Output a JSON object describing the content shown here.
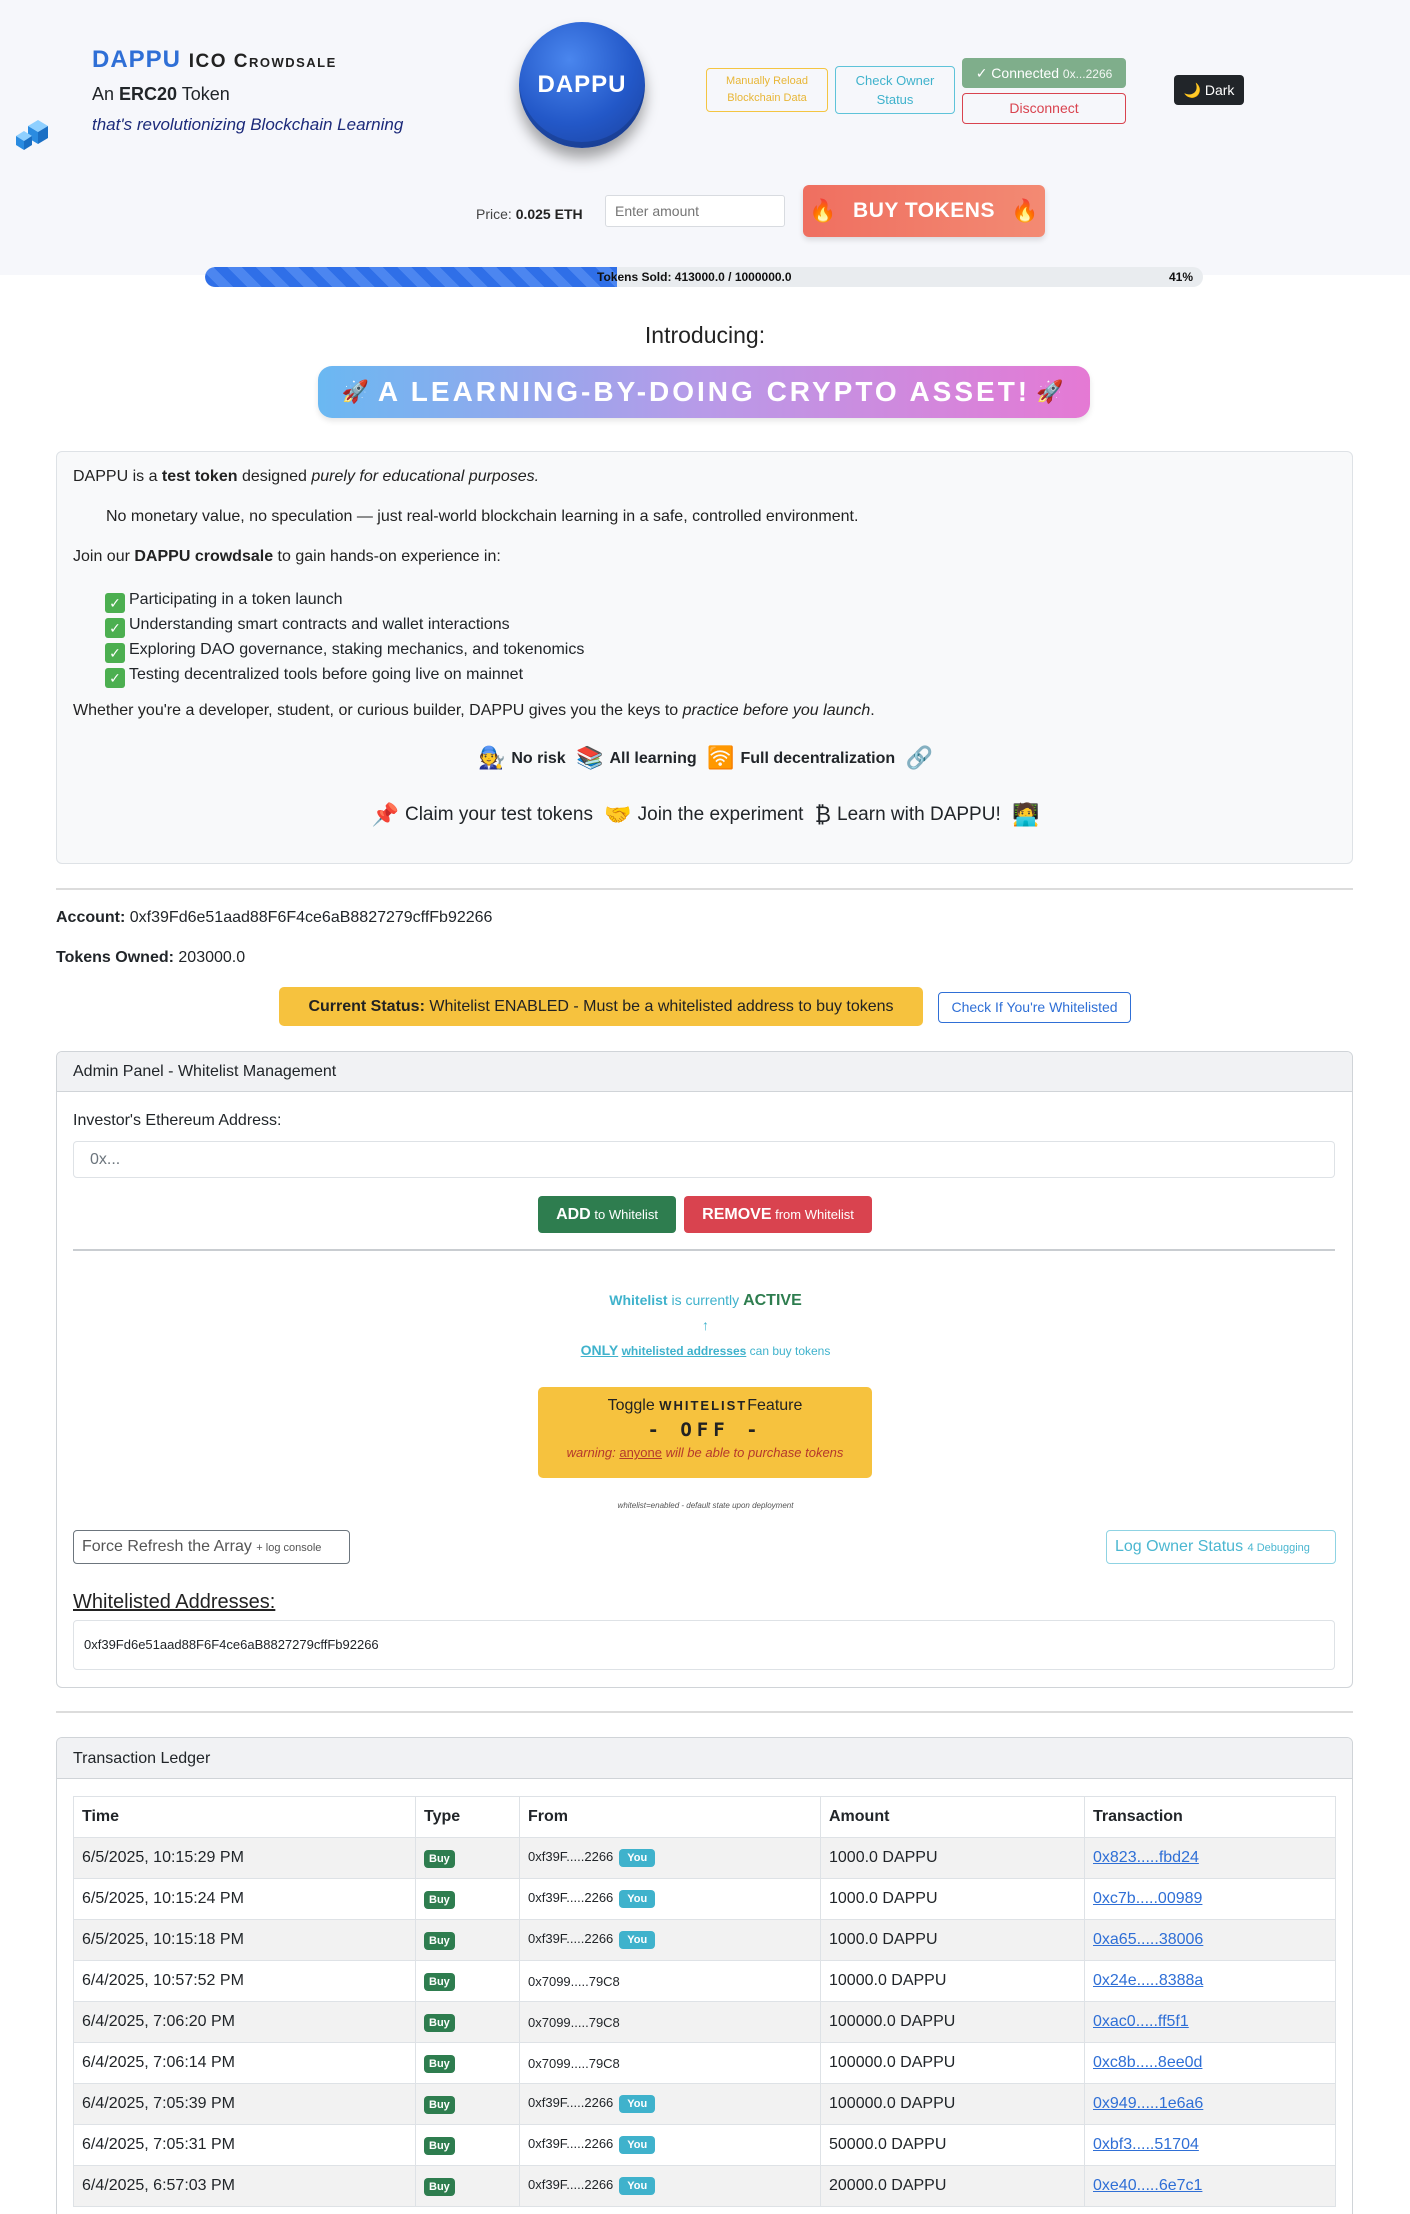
{
  "header": {
    "brand_name": "DAPPU",
    "brand_suffix": "ICO Crowdsale",
    "subtitle_pre": "An",
    "subtitle_bold": "ERC20",
    "subtitle_post": "Token",
    "tagline": "that's revolutionizing Blockchain Learning",
    "coin_label": "DAPPU",
    "reload_label": "Manually Reload Blockchain Data",
    "owner_status_label": "Check Owner Status",
    "connected_label": "✓ Connected",
    "connected_addr": "0x...2266",
    "disconnect_label": "Disconnect",
    "dark_label": "🌙 Dark",
    "icons": {
      "logo": "blue-cube-icon",
      "dark_mode": "moon-icon"
    }
  },
  "purchase": {
    "price_label": "Price:",
    "price_value": "0.025 ETH",
    "amount_placeholder": "Enter amount",
    "buy_label": "BUY TOKENS",
    "buy_icon": "🔥"
  },
  "progress": {
    "text": "Tokens Sold: 413000.0 / 1000000.0",
    "percent_label": "41%",
    "percent": 41.3,
    "color": "#2f6fe8"
  },
  "intro": {
    "heading": "Introducing:",
    "banner": "A LEARNING-BY-DOING CRYPTO ASSET!",
    "banner_icon": "🚀",
    "p1_pre": "DAPPU is a",
    "p1_bold": "test token",
    "p1_mid": "designed",
    "p1_italic": "purely for educational purposes.",
    "p2": "No monetary value, no speculation — just real-world blockchain learning in a safe, controlled environment.",
    "p3_pre": "Join our",
    "p3_bold": "DAPPU crowdsale",
    "p3_post": "to gain hands-on experience in:",
    "items": [
      "Participating in a token launch",
      "Understanding smart contracts and wallet interactions",
      "Exploring DAO governance, staking mechanics, and tokenomics",
      "Testing decentralized tools before going live on mainnet"
    ],
    "p4_pre": "Whether you're a developer, student, or curious builder, DAPPU gives you the keys to",
    "p4_italic": "practice before you launch",
    "p4_post": ".",
    "features": [
      "No risk",
      "All learning",
      "Full decentralization"
    ],
    "feature_icons": [
      "🧑‍🔧",
      "📚",
      "🛜",
      "🔗"
    ],
    "claims": [
      "Claim your test tokens",
      "Join the experiment",
      "Learn with DAPPU!"
    ],
    "claim_icons": [
      "📌",
      "🤝",
      "₿",
      "🧑‍💻"
    ]
  },
  "account": {
    "account_label": "Account:",
    "account_value": "0xf39Fd6e51aad88F6F4ce6aB8827279cffFb92266",
    "tokens_label": "Tokens Owned:",
    "tokens_value": "203000.0",
    "status_label": "Current Status:",
    "status_value": "Whitelist ENABLED - Must be a whitelisted address to buy tokens",
    "check_wl_label": "Check If You're Whitelisted"
  },
  "admin": {
    "title": "Admin Panel - Whitelist Management",
    "address_label": "Investor's Ethereum Address:",
    "address_placeholder": "0x...",
    "add_bold": "ADD",
    "add_rest": "to Whitelist",
    "remove_bold": "REMOVE",
    "remove_rest": "from Whitelist",
    "active_pre": "Whitelist",
    "active_mid": "is currently",
    "active_state": "ACTIVE",
    "arrow": "↑",
    "only_word": "ONLY",
    "only_link": "whitelisted addresses",
    "only_post": "can buy tokens",
    "toggle_pre": "Toggle",
    "toggle_word": "WHITELIST",
    "toggle_post": "Feature",
    "toggle_state": "- OFF -",
    "warning_pre": "warning:",
    "warning_u": "anyone",
    "warning_post": "will be able to purchase tokens",
    "default_note": "whitelist=enabled - default state upon deployment",
    "force_label": "Force Refresh the Array",
    "force_small": "+ log console",
    "log_label": "Log Owner Status",
    "log_small": "4 Debugging",
    "wl_heading": "Whitelisted Addresses:",
    "wl_addresses": [
      "0xf39Fd6e51aad88F6F4ce6aB8827279cffFb92266"
    ]
  },
  "ledger": {
    "title": "Transaction Ledger",
    "columns": [
      "Time",
      "Type",
      "From",
      "Amount",
      "Transaction"
    ],
    "you_label": "You",
    "rows": [
      {
        "time": "6/5/2025, 10:15:29 PM",
        "type": "Buy",
        "from": "0xf39F.....2266",
        "you": true,
        "amount": "1000.0 DAPPU",
        "tx": "0x823.....fbd24"
      },
      {
        "time": "6/5/2025, 10:15:24 PM",
        "type": "Buy",
        "from": "0xf39F.....2266",
        "you": true,
        "amount": "1000.0 DAPPU",
        "tx": "0xc7b.....00989"
      },
      {
        "time": "6/5/2025, 10:15:18 PM",
        "type": "Buy",
        "from": "0xf39F.....2266",
        "you": true,
        "amount": "1000.0 DAPPU",
        "tx": "0xa65.....38006"
      },
      {
        "time": "6/4/2025, 10:57:52 PM",
        "type": "Buy",
        "from": "0x7099.....79C8",
        "you": false,
        "amount": "10000.0 DAPPU",
        "tx": "0x24e.....8388a"
      },
      {
        "time": "6/4/2025, 7:06:20 PM",
        "type": "Buy",
        "from": "0x7099.....79C8",
        "you": false,
        "amount": "100000.0 DAPPU",
        "tx": "0xac0.....ff5f1"
      },
      {
        "time": "6/4/2025, 7:06:14 PM",
        "type": "Buy",
        "from": "0x7099.....79C8",
        "you": false,
        "amount": "100000.0 DAPPU",
        "tx": "0xc8b.....8ee0d"
      },
      {
        "time": "6/4/2025, 7:05:39 PM",
        "type": "Buy",
        "from": "0xf39F.....2266",
        "you": true,
        "amount": "100000.0 DAPPU",
        "tx": "0x949.....1e6a6"
      },
      {
        "time": "6/4/2025, 7:05:31 PM",
        "type": "Buy",
        "from": "0xf39F.....2266",
        "you": true,
        "amount": "50000.0 DAPPU",
        "tx": "0xbf3.....51704"
      },
      {
        "time": "6/4/2025, 6:57:03 PM",
        "type": "Buy",
        "from": "0xf39F.....2266",
        "you": true,
        "amount": "20000.0 DAPPU",
        "tx": "0xe40.....6e7c1"
      }
    ]
  }
}
